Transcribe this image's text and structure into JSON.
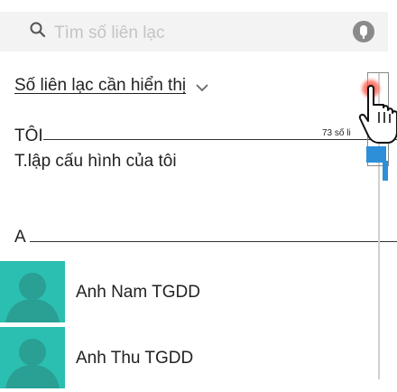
{
  "search": {
    "placeholder": "Tìm số liên lạc"
  },
  "filter": {
    "label": "Số liên lạc cần hiển thị"
  },
  "sections": [
    {
      "header": "TÔI"
    },
    {
      "header": "A"
    }
  ],
  "config": {
    "label": "T.lập cấu hình của tôi"
  },
  "contacts": [
    {
      "name": "Anh Nam TGDD"
    },
    {
      "name": "Anh Thu TGDD"
    }
  ],
  "scroll": {
    "count_label": "73 số li"
  },
  "colors": {
    "avatar_bg": "#2bbfb1",
    "scroll_accent": "#2d8fd8",
    "highlight": "#e8231f"
  },
  "icons": [
    "search-icon",
    "microphone-icon",
    "chevron-down-icon",
    "default-avatar-icon",
    "hand-pointer-icon"
  ]
}
